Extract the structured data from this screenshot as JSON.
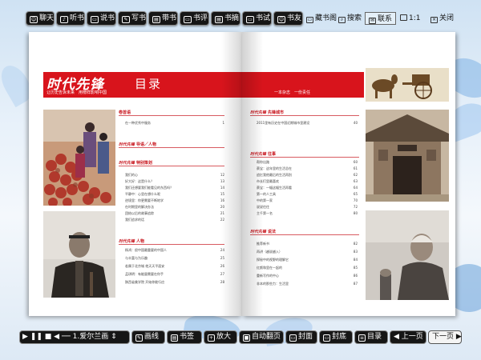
{
  "top_toolbar": {
    "chat": "聊天",
    "listen": "听书",
    "tell": "说书",
    "write": "写书",
    "carry": "带书",
    "review": "书评",
    "summary": "书摘",
    "test": "书试",
    "friends": "书友",
    "bookshelf": "藏书阁",
    "search": "搜索",
    "contact": "联系",
    "ratio": "1:1",
    "close": "关闭"
  },
  "magazine": {
    "title": "时代先锋",
    "slogan": "让历史告诉未来　用榜样影响中国",
    "toc": "目录",
    "right_slogan": "一本杂志　一份责任",
    "logo": "时代先锋"
  },
  "toc_left": [
    {
      "section": "卷首语",
      "items": [
        {
          "t": "在一种优秀中服务",
          "p": "1"
        }
      ]
    },
    {
      "section": "导语／人物",
      "items": []
    },
    {
      "section": "特别策划",
      "items": [
        {
          "t": "我们的心",
          "p": "12"
        },
        {
          "t": "好大好：这是什么？",
          "p": "13"
        },
        {
          "t": "我们还想要我们能看见的东西吗？",
          "p": "14"
        },
        {
          "t": "平静中：心里在想什么呢",
          "p": "15"
        },
        {
          "t": "逆境里：你更需要不断地学",
          "p": "16"
        },
        {
          "t": "在时期里的解决办法",
          "p": "20"
        },
        {
          "t": "团结以后的故事追踪",
          "p": "21"
        },
        {
          "t": "我们追求的话",
          "p": "22"
        }
      ]
    },
    {
      "section": "人物",
      "items": [
        {
          "t": "杨鸿：很中国最重要的中国人",
          "p": "24"
        },
        {
          "t": "与丰富与为乐趣",
          "p": "25"
        },
        {
          "t": "若属于北京城 他天天平面安",
          "p": "26"
        },
        {
          "t": "孟琪明：有能量需要在你手",
          "p": "27"
        },
        {
          "t": "陕西省美学院 开始你能行应",
          "p": "28"
        }
      ]
    }
  ],
  "toc_right": [
    {
      "section": "先锋城市",
      "items": [
        {
          "t": "2011里有历史在中国近期城市里建设",
          "p": "40"
        }
      ]
    },
    {
      "section": "往事",
      "items": [
        {
          "t": "帮你出路",
          "p": "60"
        },
        {
          "t": "蔡宝：这年里的生活总在",
          "p": "61"
        },
        {
          "t": "追忆我他最后的生活再别",
          "p": "62"
        },
        {
          "t": "市长们里最喜欢",
          "p": "63"
        },
        {
          "t": "蔡宝：一幅这幅生活再看",
          "p": "64"
        },
        {
          "t": "第一的人工具",
          "p": "65"
        },
        {
          "t": "中的第一家",
          "p": "70"
        },
        {
          "t": "说说往往",
          "p": "72"
        },
        {
          "t": "主千第一名",
          "p": "80"
        }
      ]
    },
    {
      "section": "说法",
      "items": [
        {
          "t": "推荐新书",
          "p": "82"
        },
        {
          "t": "再讲（越说越入）",
          "p": "83"
        },
        {
          "t": "探秘中的视野的理解它",
          "p": "84"
        },
        {
          "t": "红颜和里在一起的",
          "p": "85"
        },
        {
          "t": "重新写作的中心",
          "p": "86"
        },
        {
          "t": "非本的那些力：生活里",
          "p": "87"
        }
      ]
    }
  ],
  "bottom_toolbar": {
    "track": "1.爱尔兰画",
    "draw": "画线",
    "bookmark": "书签",
    "zoom": "放大",
    "autoflip": "自动翻页",
    "cover": "封面",
    "back_cover": "封底",
    "contents": "目录",
    "prev": "上一页",
    "next": "下一页"
  },
  "colors": {
    "accent_red": "#d8141c",
    "toolbar_bg": "#161616"
  }
}
